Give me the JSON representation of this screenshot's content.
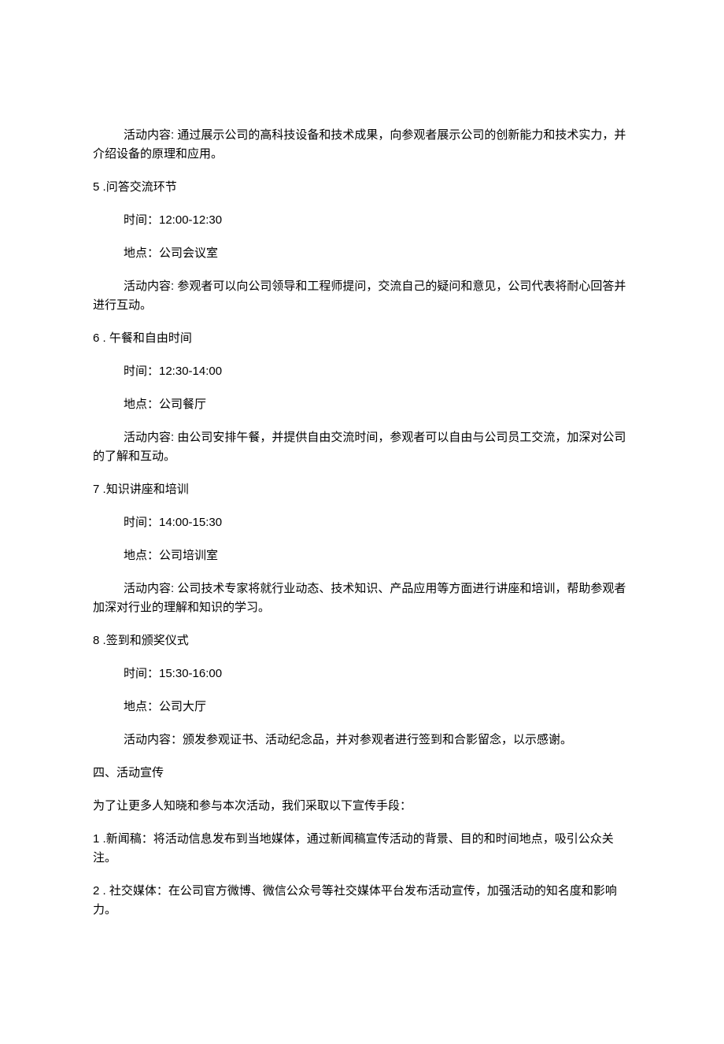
{
  "section4": {
    "content": "活动内容: 通过展示公司的高科技设备和技术成果，向参观者展示公司的创新能力和技术实力，并介绍设备的原理和应用。"
  },
  "section5": {
    "num": "5",
    "sep": " .",
    "title": "问答交流环节",
    "time": "时间：12:00-12:30",
    "place": "地点：公司会议室",
    "content": "活动内容: 参观者可以向公司领导和工程师提问，交流自己的疑问和意见，公司代表将耐心回答并进行互动。"
  },
  "section6": {
    "num": "6",
    "sep": " . ",
    "title": "午餐和自由时间",
    "time": "时间：12:30-14:00",
    "place": "地点：公司餐厅",
    "content": "活动内容: 由公司安排午餐，并提供自由交流时间，参观者可以自由与公司员工交流，加深对公司的了解和互动。"
  },
  "section7": {
    "num": "7",
    "sep": " .",
    "title": "知识讲座和培训",
    "time": "时间：14:00-15:30",
    "place": "地点：公司培训室",
    "content": "活动内容: 公司技术专家将就行业动态、技术知识、产品应用等方面进行讲座和培训，帮助参观者加深对行业的理解和知识的学习。"
  },
  "section8": {
    "num": "8",
    "sep": " .",
    "title": "签到和颁奖仪式",
    "time": "时间：15:30-16:00",
    "place": "地点：公司大厅",
    "content": "活动内容：颁发参观证书、活动纪念品，并对参观者进行签到和合影留念，以示感谢。"
  },
  "promo": {
    "heading": "四、活动宣传",
    "intro": "为了让更多人知晓和参与本次活动，我们采取以下宣传手段：",
    "item1_num": "1",
    "item1_sep": " .",
    "item1_text": "新闻稿：将活动信息发布到当地媒体，通过新闻稿宣传活动的背景、目的和时间地点，吸引公众关注。",
    "item2_num": "2",
    "item2_sep": " . ",
    "item2_text": "社交媒体：在公司官方微博、微信公众号等社交媒体平台发布活动宣传，加强活动的知名度和影响力。"
  }
}
